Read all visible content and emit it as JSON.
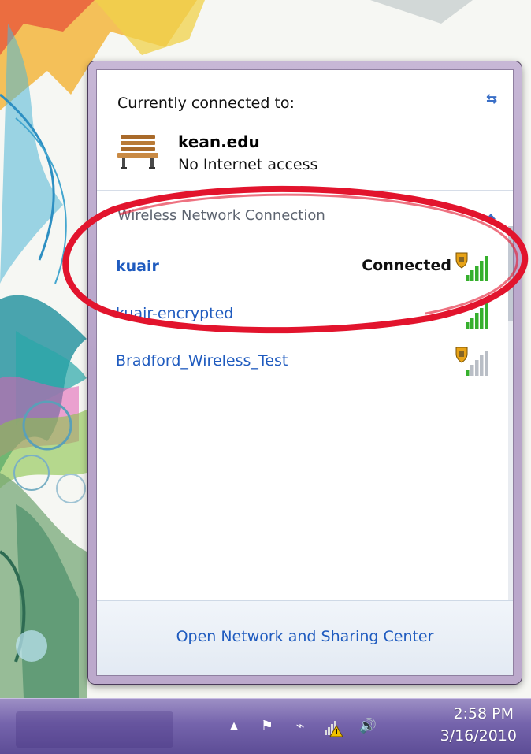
{
  "flyout": {
    "refresh_icon": "refresh-icon",
    "current_header": "Currently connected to:",
    "current_network": {
      "icon": "park-bench-icon",
      "name": "kean.edu",
      "status": "No Internet access"
    },
    "section": {
      "header": "Wireless Network Connection",
      "collapse_icon": "chevron-up-icon"
    },
    "networks": [
      {
        "name": "kuair",
        "status": "Connected",
        "secured": true,
        "signal_bars": 5,
        "signal_color": "#36b02d"
      },
      {
        "name": "kuair-encrypted",
        "status": "",
        "secured": false,
        "signal_bars": 5,
        "signal_color": "#36b02d"
      },
      {
        "name": "Bradford_Wireless_Test",
        "status": "",
        "secured": true,
        "signal_bars": 1,
        "signal_color": "#36b02d"
      }
    ],
    "footer_link": "Open Network and Sharing Center"
  },
  "annotation": {
    "shape": "ellipse",
    "color": "#e2142d"
  },
  "taskbar": {
    "tray_icons": [
      "show-hidden-icons-arrow-icon",
      "action-center-flag-icon",
      "power-plug-icon",
      "network-warning-icon",
      "volume-icon"
    ],
    "clock": {
      "time": "2:58 PM",
      "date": "3/16/2010"
    }
  },
  "colors": {
    "link": "#1f5bbf",
    "taskbar": "#7564ac",
    "flyout_border": "#b6a3c8",
    "annotation": "#e2142d"
  }
}
